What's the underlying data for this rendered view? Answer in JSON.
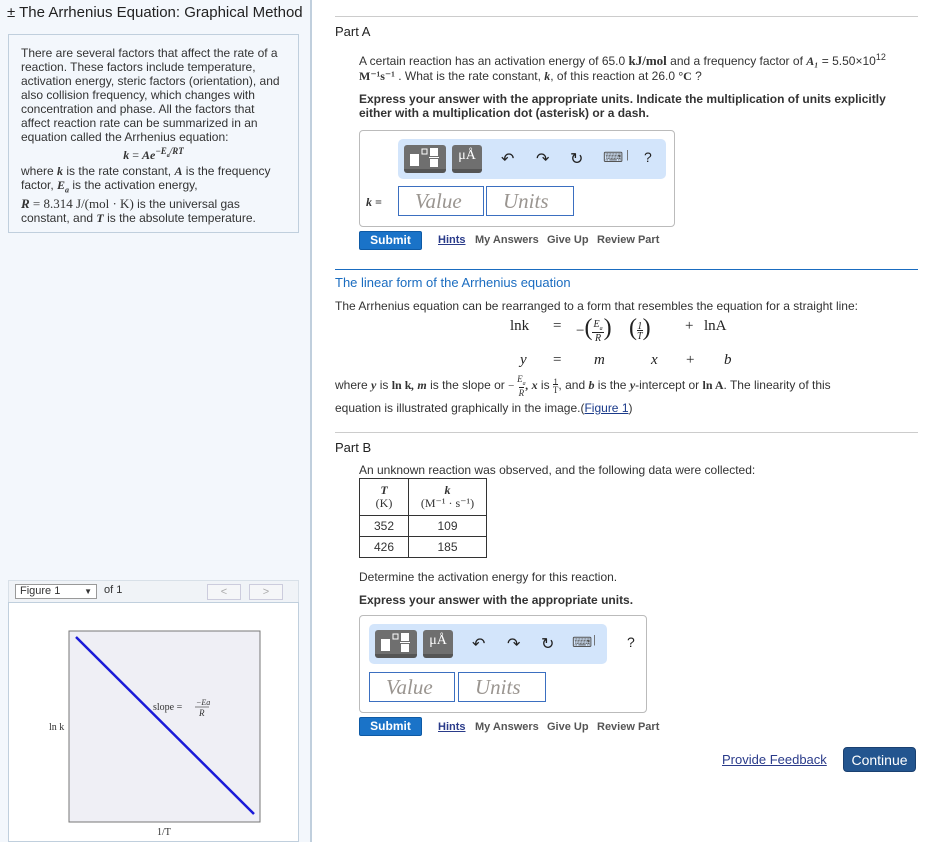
{
  "title": "± The Arrhenius Equation: Graphical Method",
  "intro": {
    "paragraph": "There are several factors that affect the rate of a reaction. These factors include temperature, activation energy, steric factors (orientation), and also collision frequency, which changes with concentration and phase. All the factors that affect reaction rate can be summarized in an equation called the Arrhenius equation:",
    "equation": "k = Ae^(−Ea/RT)",
    "where_1": "where",
    "where_k": "k",
    "where_2": " is the rate constant, ",
    "where_A": "A",
    "where_3": " is the frequency factor, ",
    "where_Ea": "Ea",
    "where_4": " is the activation energy,",
    "where_R": "R = 8.314 J/(mol · K)",
    "where_5": " is the universal gas constant, and ",
    "where_T": "T",
    "where_6": " is the absolute temperature."
  },
  "figure_nav": {
    "select_value": "Figure 1",
    "of_label": "of 1",
    "prev": "<",
    "next": ">"
  },
  "figure": {
    "ylabel": "ln k",
    "xlabel": "1/T",
    "slope_label": "slope =",
    "slope_num": "−Ea",
    "slope_den": "R"
  },
  "partA": {
    "title": "Part A",
    "q1": "A certain reaction has an activation energy of 65.0 ",
    "q_unit1": "kJ/mol",
    "q2": " and a frequency factor of ",
    "q_A1": "A₁",
    "q3": " = 5.50×10",
    "q_exp": "12",
    "q_unit2": "M⁻¹s⁻¹",
    "q4": " . What is the rate constant, ",
    "q_k": "k",
    "q5": ", of this reaction at 26.0 ",
    "q_degC": "°C",
    "q6": " ?",
    "instruction": "Express your answer with the appropriate units. Indicate the multiplication of units explicitly either with a multiplication dot (asterisk) or a dash.",
    "var_label": "k =",
    "value_placeholder": "Value",
    "units_placeholder": "Units",
    "submit": "Submit",
    "hints": "Hints",
    "my_answers": "My Answers",
    "give_up": "Give Up",
    "review_part": "Review Part"
  },
  "toolbar": {
    "templates_icon": "templates-icon",
    "units_label": "μÅ",
    "undo": "↶",
    "redo": "↷",
    "reset": "↻",
    "keyboard": "⌨",
    "sep": "|",
    "help": "?"
  },
  "linear": {
    "title": "The linear form of the Arrhenius equation",
    "intro": "The Arrhenius equation can be rearranged to a form that resembles the equation for a straight line:",
    "eq1": [
      "lnk",
      "=",
      "−(Ea/R)",
      "(1/T)",
      "+",
      "lnA"
    ],
    "eq2": [
      "y",
      "=",
      "m",
      "x",
      "+",
      "b"
    ],
    "where1": "where ",
    "y": "y",
    "is1": " is ",
    "lnk": "ln k",
    "m": ", m",
    "is2": " is the slope or ",
    "slope": "−Ea/R",
    "x": ", x",
    "is3": " is ",
    "invT": "1/T",
    "and_b": ", and ",
    "b": "b",
    "is4": " is the ",
    "yint": "y",
    "is5": "-intercept or ",
    "lnA": "ln A",
    "is6": ". The linearity of this",
    "line2": "equation is illustrated graphically in the image.(",
    "figlink": "Figure 1",
    "close": ")"
  },
  "partB": {
    "title": "Part B",
    "intro": "An unknown reaction was observed, and the following data were collected:",
    "table": {
      "headers": [
        [
          "T",
          "(K)"
        ],
        [
          "k",
          "(M⁻¹ · s⁻¹)"
        ]
      ],
      "rows": [
        [
          "352",
          "109"
        ],
        [
          "426",
          "185"
        ]
      ]
    },
    "question": "Determine the activation energy for this reaction.",
    "instruction": "Express your answer with the appropriate units.",
    "value_placeholder": "Value",
    "units_placeholder": "Units",
    "submit": "Submit",
    "hints": "Hints",
    "my_answers": "My Answers",
    "give_up": "Give Up",
    "review_part": "Review Part"
  },
  "footer": {
    "feedback": "Provide Feedback",
    "continue": "Continue"
  }
}
